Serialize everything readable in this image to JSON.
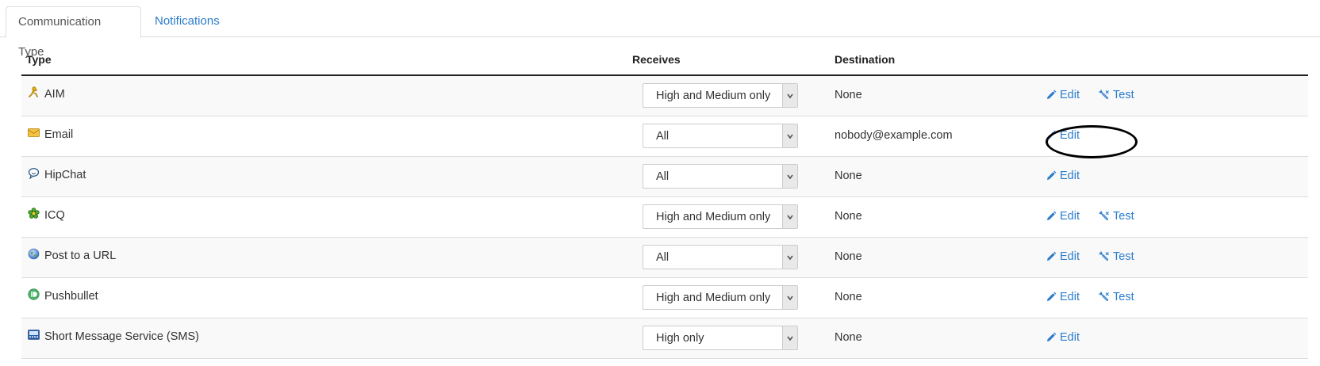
{
  "tabs": {
    "active": "Communication Type",
    "inactive": "Notifications"
  },
  "table": {
    "headers": {
      "type": "Type",
      "receives": "Receives",
      "destination": "Destination"
    },
    "rows": [
      {
        "type": "AIM",
        "icon": "aim-icon",
        "receives": "High and Medium only",
        "destination": "None",
        "edit": "Edit",
        "test": "Test"
      },
      {
        "type": "Email",
        "icon": "email-icon",
        "receives": "All",
        "destination": "nobody@example.com",
        "edit": "Edit",
        "test": ""
      },
      {
        "type": "HipChat",
        "icon": "hipchat-icon",
        "receives": "All",
        "destination": "None",
        "edit": "Edit",
        "test": ""
      },
      {
        "type": "ICQ",
        "icon": "icq-icon",
        "receives": "High and Medium only",
        "destination": "None",
        "edit": "Edit",
        "test": "Test"
      },
      {
        "type": "Post to a URL",
        "icon": "globe-icon",
        "receives": "All",
        "destination": "None",
        "edit": "Edit",
        "test": "Test"
      },
      {
        "type": "Pushbullet",
        "icon": "pushbullet-icon",
        "receives": "High and Medium only",
        "destination": "None",
        "edit": "Edit",
        "test": "Test"
      },
      {
        "type": "Short Message Service (SMS)",
        "icon": "sms-icon",
        "receives": "High only",
        "destination": "None",
        "edit": "Edit",
        "test": ""
      }
    ]
  },
  "colors": {
    "link": "#2a7ccc",
    "text": "#333333",
    "header_border": "#222222",
    "row_border": "#dddddd",
    "row_stripe": "#f9f9f9"
  },
  "annotation": {
    "shape": "oval",
    "target": "email-edit-link",
    "color": "#000000"
  }
}
